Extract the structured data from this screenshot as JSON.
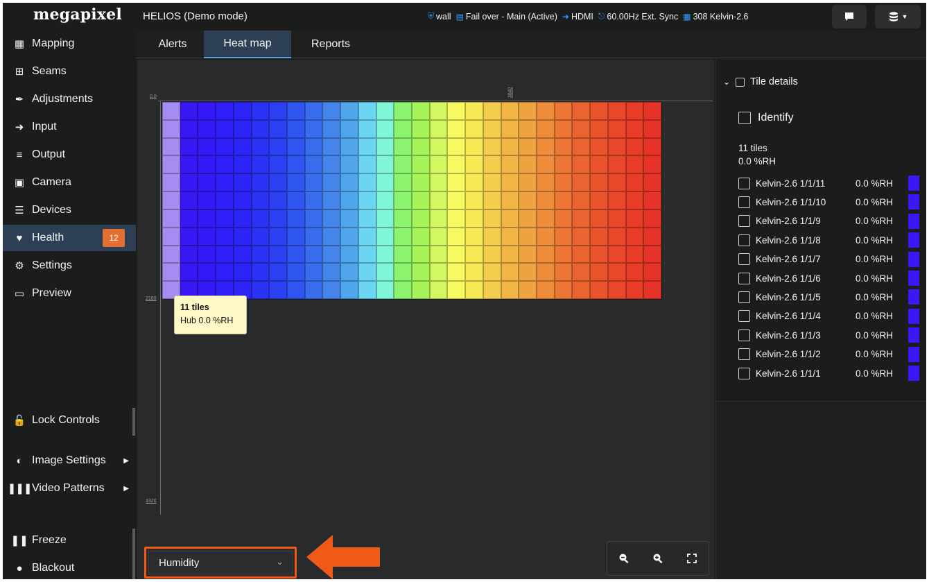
{
  "header": {
    "logo": "megapixel",
    "title": "HELIOS (Demo mode)",
    "status": [
      {
        "icon": "database-icon",
        "label": "wall"
      },
      {
        "icon": "server-icon",
        "label": "Fail over - Main (Active)"
      },
      {
        "icon": "input-icon",
        "label": "HDMI"
      },
      {
        "icon": "pulse-icon",
        "label": "60.00Hz Ext. Sync"
      },
      {
        "icon": "grid-icon",
        "label": "308 Kelvin-2.6"
      }
    ]
  },
  "sidebar": {
    "items": [
      {
        "label": "Mapping",
        "icon": "grid-icon"
      },
      {
        "label": "Seams",
        "icon": "plus-square-icon"
      },
      {
        "label": "Adjustments",
        "icon": "brush-icon"
      },
      {
        "label": "Input",
        "icon": "sign-in-icon"
      },
      {
        "label": "Output",
        "icon": "sliders-icon"
      },
      {
        "label": "Camera",
        "icon": "film-icon"
      },
      {
        "label": "Devices",
        "icon": "list-icon"
      },
      {
        "label": "Health",
        "icon": "heart-pulse-icon",
        "badge": "12",
        "active": true
      },
      {
        "label": "Settings",
        "icon": "gears-icon"
      },
      {
        "label": "Preview",
        "icon": "monitor-icon"
      }
    ],
    "lock_controls": "Lock Controls",
    "image_settings": "Image Settings",
    "video_patterns": "Video Patterns",
    "freeze": "Freeze",
    "blackout": "Blackout"
  },
  "tabs": [
    {
      "label": "Alerts"
    },
    {
      "label": "Heat map",
      "active": true
    },
    {
      "label": "Reports"
    }
  ],
  "heatmap": {
    "axis_top_left": "0,0",
    "axis_top_right": "3840",
    "axis_left_mid": "2160",
    "axis_left_bottom": "4320",
    "columns": 28,
    "rows": 11,
    "column_colors": [
      "#a58cf3",
      "#3a17f5",
      "#3519f7",
      "#2f1ef7",
      "#2b26f7",
      "#2a32f6",
      "#2b40f3",
      "#2f55f0",
      "#3a6cee",
      "#4485ea",
      "#51a5ea",
      "#6cd6f2",
      "#80f6d6",
      "#8bf36e",
      "#a6f45a",
      "#d2f760",
      "#f7f960",
      "#f6e955",
      "#f3cd4d",
      "#f1b645",
      "#efa240",
      "#ee8c3b",
      "#ec7636",
      "#ea6331",
      "#e9542d",
      "#e8472a",
      "#e73c28",
      "#e63327"
    ],
    "tooltip_title": "11 tiles",
    "tooltip_value": "Hub 0.0 %RH"
  },
  "metric_select": {
    "value": "Humidity"
  },
  "zoom": {
    "zoom_out": "zoom-out-icon",
    "zoom_in": "zoom-in-icon",
    "fullscreen": "fullscreen-icon"
  },
  "tile_details": {
    "header": "Tile details",
    "identify": "Identify",
    "summary_count": "11 tiles",
    "summary_value": "0.0 %RH",
    "tiles": [
      {
        "name": "Kelvin-2.6 1/1/11",
        "value": "0.0 %RH"
      },
      {
        "name": "Kelvin-2.6 1/1/10",
        "value": "0.0 %RH"
      },
      {
        "name": "Kelvin-2.6 1/1/9",
        "value": "0.0 %RH"
      },
      {
        "name": "Kelvin-2.6 1/1/8",
        "value": "0.0 %RH"
      },
      {
        "name": "Kelvin-2.6 1/1/7",
        "value": "0.0 %RH"
      },
      {
        "name": "Kelvin-2.6 1/1/6",
        "value": "0.0 %RH"
      },
      {
        "name": "Kelvin-2.6 1/1/5",
        "value": "0.0 %RH"
      },
      {
        "name": "Kelvin-2.6 1/1/4",
        "value": "0.0 %RH"
      },
      {
        "name": "Kelvin-2.6 1/1/3",
        "value": "0.0 %RH"
      },
      {
        "name": "Kelvin-2.6 1/1/2",
        "value": "0.0 %RH"
      },
      {
        "name": "Kelvin-2.6 1/1/1",
        "value": "0.0 %RH"
      }
    ],
    "swatch_color": "#3a17f5"
  },
  "colors": {
    "accent_active": "#2d3f55",
    "badge": "#e46f33",
    "highlight": "#f05a17",
    "icon_blue": "#2f9bff"
  }
}
